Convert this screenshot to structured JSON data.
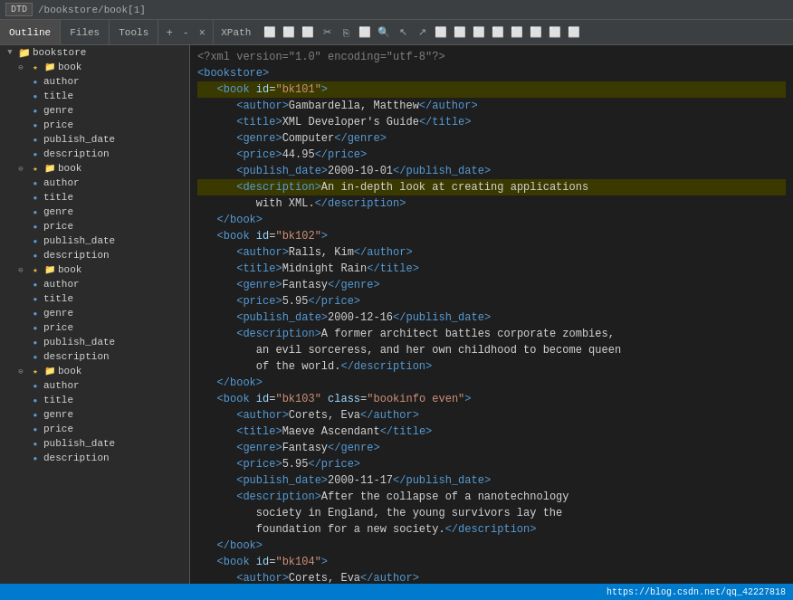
{
  "topbar": {
    "dtd_label": "DTD",
    "breadcrumb": "/bookstore/book[1]"
  },
  "tabs": {
    "outline_label": "Outline",
    "files_label": "Files",
    "tools_label": "Tools",
    "xpath_label": "XPath",
    "add_label": "+",
    "minus_label": "-",
    "close_label": "×"
  },
  "tree": {
    "items": [
      {
        "indent": 0,
        "type": "root",
        "label": "bookstore",
        "expand": false
      },
      {
        "indent": 1,
        "type": "folder",
        "label": "book",
        "expand": true,
        "star": true
      },
      {
        "indent": 2,
        "type": "leaf",
        "label": "author"
      },
      {
        "indent": 2,
        "type": "leaf",
        "label": "title"
      },
      {
        "indent": 2,
        "type": "leaf",
        "label": "genre"
      },
      {
        "indent": 2,
        "type": "leaf",
        "label": "price"
      },
      {
        "indent": 2,
        "type": "leaf",
        "label": "publish_date"
      },
      {
        "indent": 2,
        "type": "leaf",
        "label": "description"
      },
      {
        "indent": 1,
        "type": "folder",
        "label": "book",
        "expand": true,
        "star": true
      },
      {
        "indent": 2,
        "type": "leaf",
        "label": "author"
      },
      {
        "indent": 2,
        "type": "leaf",
        "label": "title"
      },
      {
        "indent": 2,
        "type": "leaf",
        "label": "genre"
      },
      {
        "indent": 2,
        "type": "leaf",
        "label": "price"
      },
      {
        "indent": 2,
        "type": "leaf",
        "label": "publish_date"
      },
      {
        "indent": 2,
        "type": "leaf",
        "label": "description"
      },
      {
        "indent": 1,
        "type": "folder",
        "label": "book",
        "expand": true,
        "star": true
      },
      {
        "indent": 2,
        "type": "leaf",
        "label": "author"
      },
      {
        "indent": 2,
        "type": "leaf",
        "label": "title"
      },
      {
        "indent": 2,
        "type": "leaf",
        "label": "genre"
      },
      {
        "indent": 2,
        "type": "leaf",
        "label": "price"
      },
      {
        "indent": 2,
        "type": "leaf",
        "label": "publish_date"
      },
      {
        "indent": 2,
        "type": "leaf",
        "label": "description"
      },
      {
        "indent": 1,
        "type": "folder",
        "label": "book",
        "expand": true,
        "star": true
      },
      {
        "indent": 2,
        "type": "leaf",
        "label": "author"
      },
      {
        "indent": 2,
        "type": "leaf",
        "label": "title"
      },
      {
        "indent": 2,
        "type": "leaf",
        "label": "genre"
      },
      {
        "indent": 2,
        "type": "leaf",
        "label": "price"
      },
      {
        "indent": 2,
        "type": "leaf",
        "label": "publish_date"
      },
      {
        "indent": 2,
        "type": "leaf",
        "label": "description"
      }
    ]
  },
  "status": {
    "url": "https://blog.csdn.net/qq_42227818"
  }
}
